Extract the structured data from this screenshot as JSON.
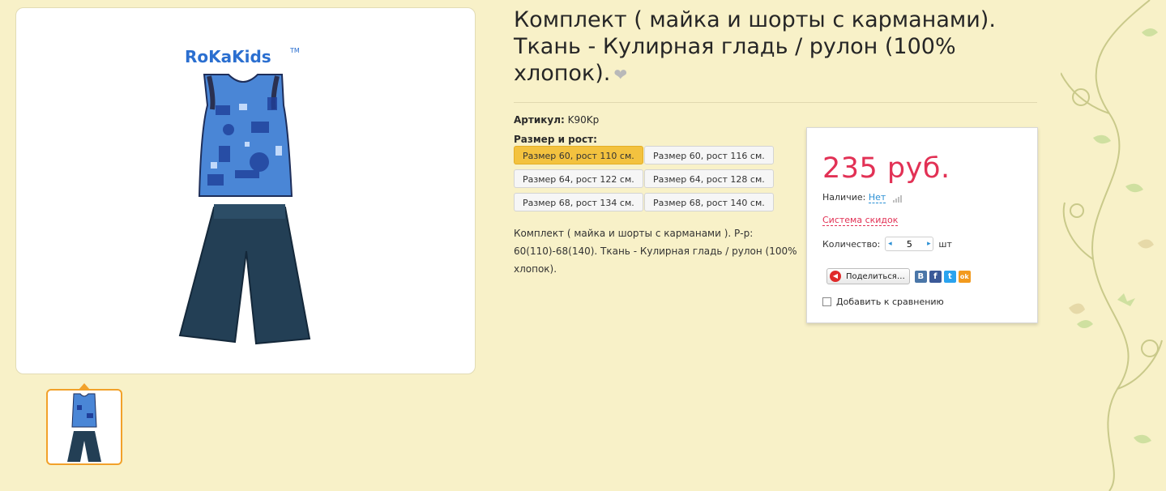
{
  "product": {
    "title": "Комплект ( майка и шорты с карманами). Ткань - Кулирная гладь / рулон (100% хлопок).",
    "favorite_icon": "heart-icon",
    "brand_logo": "RoKaKids",
    "sku_label": "Артикул:",
    "sku_value": "K90Kp",
    "size_label": "Размер и рост:",
    "sizes": [
      "Размер 60, рост 110 см.",
      "Размер 60, рост 116 см.",
      "Размер 64, рост 122 см.",
      "Размер 64, рост 128 см.",
      "Размер 68, рост 134 см.",
      "Размер 68, рост 140 см."
    ],
    "selected_size": "Размер 60, рост 110 см.",
    "description": "Комплект ( майка и шорты с карманами ). Р-р: 60(110)-68(140). Ткань - Кулирная гладь / рулон (100% хлопок)."
  },
  "buybox": {
    "price": "235 руб.",
    "availability_label": "Наличие:",
    "availability_value": "Нет",
    "discount_link": "Система скидок",
    "quantity_label": "Количество:",
    "quantity_value": "5",
    "quantity_unit": "шт",
    "share_label": "Поделиться…",
    "social_icons": [
      "vk-icon",
      "facebook-icon",
      "twitter-icon",
      "odnoklassniki-icon"
    ],
    "social_glyphs": [
      "B",
      "f",
      "t",
      "ok"
    ],
    "compare_label": "Добавить к сравнению"
  },
  "colors": {
    "page_bg": "#f8f1c8",
    "price": "#e23155",
    "selected_size": "#f3c23f",
    "link": "#2a8fd4",
    "thumb_border": "#f2a12a"
  }
}
